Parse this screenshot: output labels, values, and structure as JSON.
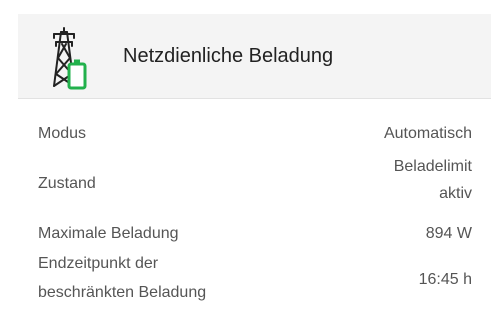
{
  "header": {
    "title": "Netzdienliche Beladung",
    "icon": "power-pylon-battery-icon",
    "icon_color": "#22b14c"
  },
  "rows": [
    {
      "label": "Modus",
      "value": "Automatisch"
    },
    {
      "label": "Zustand",
      "value": "Beladelimit aktiv"
    },
    {
      "label": "Maximale Beladung",
      "value": "894 W"
    },
    {
      "label": "Endzeitpunkt der beschränkten Beladung",
      "value": "16:45 h"
    }
  ]
}
